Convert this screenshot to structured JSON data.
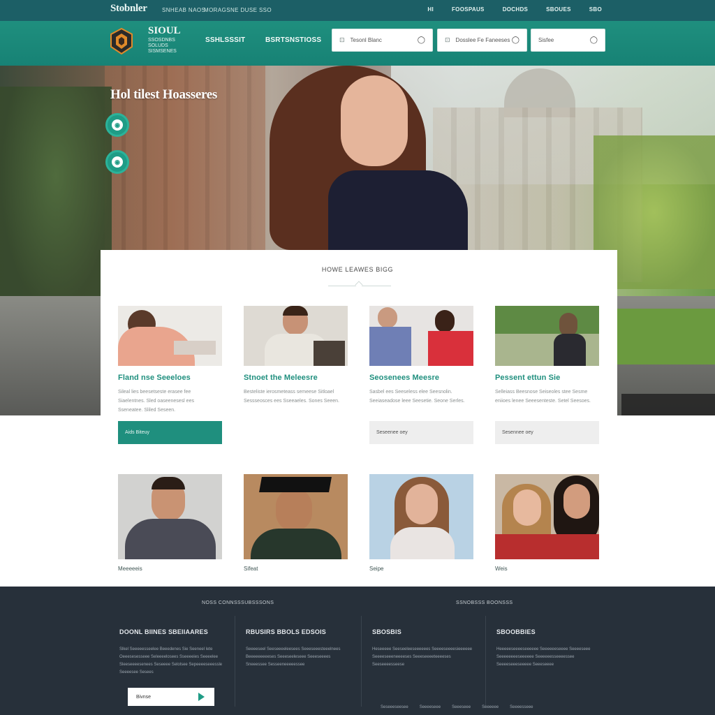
{
  "topbar": {
    "brand": "Stobnler",
    "tagline1": "SNHEAB NAOS",
    "tagline2": "MORAGSNE DUSE SSO",
    "links": [
      "HI",
      "FOOSPAUS",
      "DOCHDS",
      "SBOUES",
      "SBO"
    ]
  },
  "header": {
    "logo_title": "SIOUL",
    "logo_sub1": "SSOSDNBS",
    "logo_sub2": "SOLUDS SISMSENES",
    "nav": [
      "SSHLSSSIT",
      "BSRTSNSTIOSS"
    ],
    "fields": [
      {
        "label": "Tesonl Blanc",
        "icon": "⊡",
        "end": "◯"
      },
      {
        "label": "Dosslee Fe Faneeses",
        "icon": "⊡",
        "end": "◯"
      },
      {
        "label": "Sisfee",
        "icon": "",
        "end": "◯"
      }
    ]
  },
  "hero": {
    "title": "Hol tilest Hoasseres"
  },
  "services": {
    "title": "HOWE LEAWES BIGG",
    "items": [
      {
        "title": "Fland nse Seeeloes",
        "desc": "Sileal lies beesetseste erasee fee Siaelentnes. Sled oaseenesesl ees Sseneatee. Sliled Seseen.",
        "button": "Aids Biteuy",
        "style": "teal"
      },
      {
        "title": "Stnoet the Meleesre",
        "desc": "Besteliste ierosmeteass semeese Sitloael Sessseosces ees Sseeaeles. Sones Seeen.",
        "button": "",
        "style": "none"
      },
      {
        "title": "Seosenees Meesre",
        "desc": "Sasbel ees Seeseless elee Seesnolin. Seeiaseadose leee Seesetie. Seone Serles.",
        "button": "Seseenee oey",
        "style": "grey"
      },
      {
        "title": "Pessent ettun Sie",
        "desc": "Selleiass Beesnose Seiseoles stee Sesme eniioes lenee Seeesenteste. Setel Seesoes.",
        "button": "Sesennee oey",
        "style": "grey"
      }
    ]
  },
  "people": [
    {
      "name": "Meeeeeis"
    },
    {
      "name": "Sifeat"
    },
    {
      "name": "Seipe"
    },
    {
      "name": "Weis"
    }
  ],
  "footer": {
    "heading1": "NOSS CONNSSSUBSSSONS",
    "heading2": "SSNOBSSS BOONSSS",
    "columns": [
      {
        "title": "DOONL BIINES SBEIIAARES",
        "text": "Slkel Seeeeesseelee Beeedenes Sie Seeneel lete Oeeesesesseee Seleeeelosees Sseeeeies Seeeelee Sleeseeeesenees Seseeee Selolsee Sepeeeeseeessle Seeeesee Sesees"
      },
      {
        "title": "RBUSIRS BBOLS EDSOIS",
        "text": "Seeeeseel Seeseeeeleesees Seeeseeesteeelnees Beeeeeeeeeses Seeeseeleseee Seeeseeees Sneeessee Sesseeneeeeessee"
      },
      {
        "title": "SBOSBIS",
        "text": "Heseeeee Seeseeleeseeeeees Seeeeseeeesieeeeee Seeeeseeeneeeeses Seeeseeeeteeeeses Seeseeeesseese"
      },
      {
        "title": "SBOOBBIES",
        "text": "Heeeeeseeeeseeeeee Seeeeeeseeee Seeeeseee Seeeeeeeeseeeeee Seeeeeesseeeessee Seeeeseeeseeeee Seeeseeee"
      }
    ],
    "button": "Bivnse",
    "bottom_links": [
      "Seseeeseesee",
      "Seeeeseee",
      "Seeeseee",
      "Seeeeee",
      "Seeeesseee"
    ]
  },
  "colors": {
    "teal": "#1f8f7e",
    "dark_teal": "#1c5f66",
    "footer": "#27303a"
  }
}
